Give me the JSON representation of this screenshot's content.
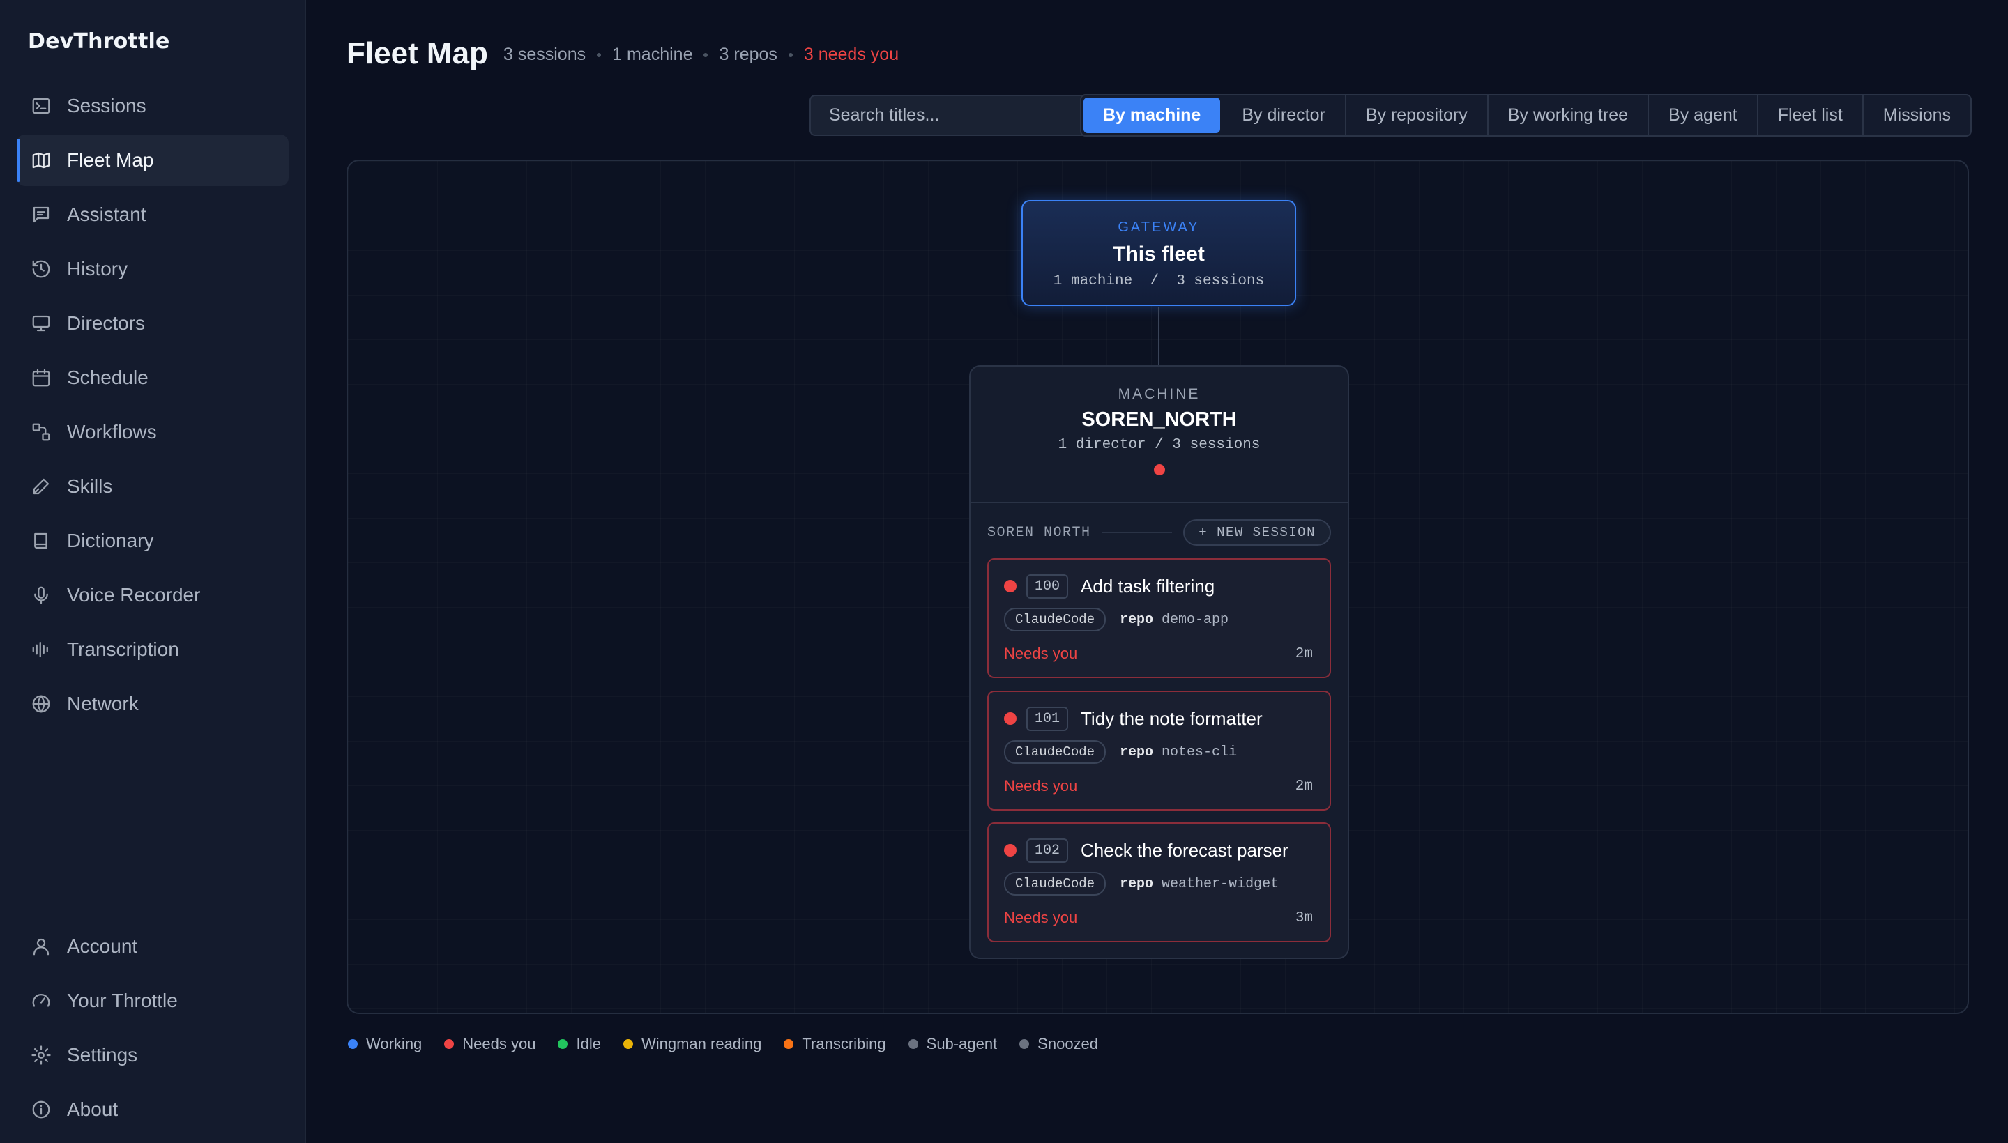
{
  "app": {
    "name": "DevThrottle"
  },
  "sidebar": {
    "items": [
      {
        "label": "Sessions",
        "icon": "terminal-icon",
        "active": false
      },
      {
        "label": "Fleet Map",
        "icon": "map-icon",
        "active": true
      },
      {
        "label": "Assistant",
        "icon": "chat-icon",
        "active": false
      },
      {
        "label": "History",
        "icon": "history-icon",
        "active": false
      },
      {
        "label": "Directors",
        "icon": "monitor-icon",
        "active": false
      },
      {
        "label": "Schedule",
        "icon": "calendar-icon",
        "active": false
      },
      {
        "label": "Workflows",
        "icon": "workflow-icon",
        "active": false
      },
      {
        "label": "Skills",
        "icon": "pen-icon",
        "active": false
      },
      {
        "label": "Dictionary",
        "icon": "book-icon",
        "active": false
      },
      {
        "label": "Voice Recorder",
        "icon": "microphone-icon",
        "active": false
      },
      {
        "label": "Transcription",
        "icon": "waveform-icon",
        "active": false
      },
      {
        "label": "Network",
        "icon": "globe-icon",
        "active": false
      }
    ],
    "bottom_items": [
      {
        "label": "Account",
        "icon": "user-icon"
      },
      {
        "label": "Your Throttle",
        "icon": "gauge-icon"
      },
      {
        "label": "Settings",
        "icon": "gear-icon"
      },
      {
        "label": "About",
        "icon": "info-icon"
      }
    ]
  },
  "header": {
    "title": "Fleet Map",
    "summary": {
      "sessions": "3 sessions",
      "machines": "1 machine",
      "repos": "3 repos",
      "needs": "3 needs you"
    }
  },
  "search": {
    "placeholder": "Search titles...",
    "value": ""
  },
  "view_tabs": [
    {
      "label": "By machine",
      "active": true
    },
    {
      "label": "By director",
      "active": false
    },
    {
      "label": "By repository",
      "active": false
    },
    {
      "label": "By working tree",
      "active": false
    },
    {
      "label": "By agent",
      "active": false
    },
    {
      "label": "Fleet list",
      "active": false
    },
    {
      "label": "Missions",
      "active": false
    }
  ],
  "gateway": {
    "kicker": "GATEWAY",
    "title": "This fleet",
    "subtitle": "1 machine  /  3 sessions"
  },
  "machine": {
    "kicker": "MACHINE",
    "name": "SOREN_NORTH",
    "subtitle": "1 director / 3 sessions",
    "group_label": "SOREN_NORTH",
    "new_session_label": "+ NEW SESSION",
    "sessions": [
      {
        "number": "100",
        "title": "Add task filtering",
        "agent": "ClaudeCode",
        "repo_key": "repo",
        "repo": "demo-app",
        "status": "Needs you",
        "age": "2m"
      },
      {
        "number": "101",
        "title": "Tidy the note formatter",
        "agent": "ClaudeCode",
        "repo_key": "repo",
        "repo": "notes-cli",
        "status": "Needs you",
        "age": "2m"
      },
      {
        "number": "102",
        "title": "Check the forecast parser",
        "agent": "ClaudeCode",
        "repo_key": "repo",
        "repo": "weather-widget",
        "status": "Needs you",
        "age": "3m"
      }
    ]
  },
  "legend": [
    {
      "label": "Working",
      "color": "#3b82f6"
    },
    {
      "label": "Needs you",
      "color": "#ef4444"
    },
    {
      "label": "Idle",
      "color": "#22c55e"
    },
    {
      "label": "Wingman reading",
      "color": "#eab308"
    },
    {
      "label": "Transcribing",
      "color": "#f97316"
    },
    {
      "label": "Sub-agent",
      "color": "#6b7280"
    },
    {
      "label": "Snoozed",
      "color": "#6b7280"
    }
  ]
}
